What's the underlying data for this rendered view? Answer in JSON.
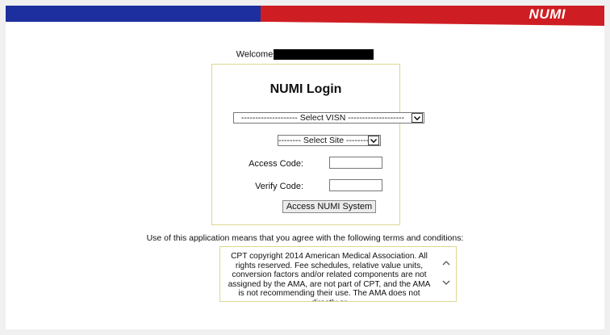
{
  "header": {
    "brand": "NUMI",
    "colors": {
      "blue": "#1d2f9e",
      "red": "#cf1e23"
    }
  },
  "welcome": {
    "label": "Welcome"
  },
  "login": {
    "title": "NUMI Login",
    "visn_select": "-------------------- Select VISN --------------------",
    "site_select": "-------- Select Site --------",
    "access_code_label": "Access Code:",
    "verify_code_label": "Verify Code:",
    "submit_label": "Access NUMI System"
  },
  "terms": {
    "intro": "Use of this application means that you agree with the following terms and conditions:",
    "text": "CPT copyright 2014 American Medical Association. All rights reserved. Fee schedules, relative value units, conversion factors and/or related components are not assigned by the AMA, are not part of CPT, and the AMA is not recommending their use. The AMA does not directly or"
  },
  "icons": {
    "dropdown": "chevron-down-icon",
    "scroll_up": "chevron-up-icon",
    "scroll_down": "chevron-down-icon"
  }
}
